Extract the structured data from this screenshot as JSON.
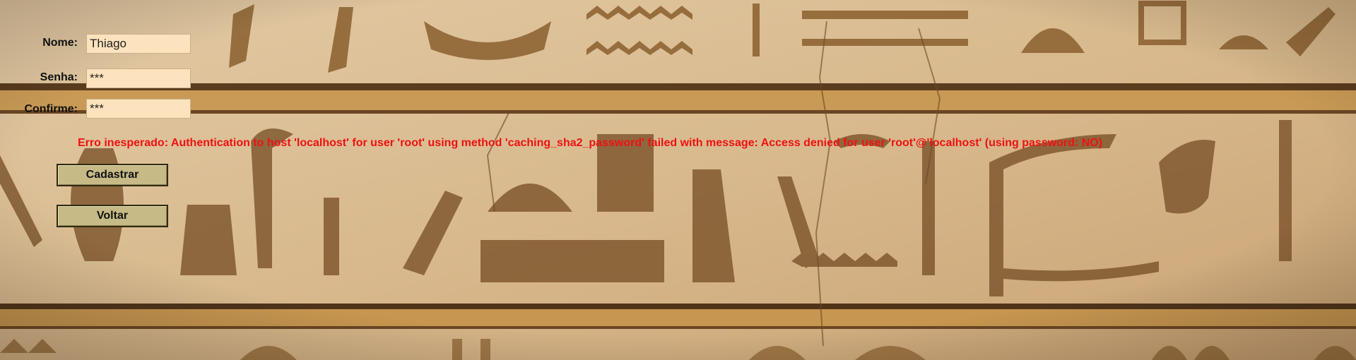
{
  "form": {
    "nome_label": "Nome:",
    "nome_value": "Thiago",
    "senha_label": "Senha:",
    "senha_value": "***",
    "confirme_label": "Confirme:",
    "confirme_value": "***"
  },
  "error": {
    "message": "Erro inesperado: Authentication to host 'localhost' for user 'root' using method 'caching_sha2_password' failed with message: Access denied for user 'root'@'localhost' (using password: NO)",
    "color": "#ef1111"
  },
  "buttons": {
    "cadastrar_label": "Cadastrar",
    "voltar_label": "Voltar"
  },
  "theme": {
    "input_bg": "#fde3bd",
    "button_bg": "#c6bb86",
    "background_image": "egyptian-hieroglyph-wall"
  }
}
